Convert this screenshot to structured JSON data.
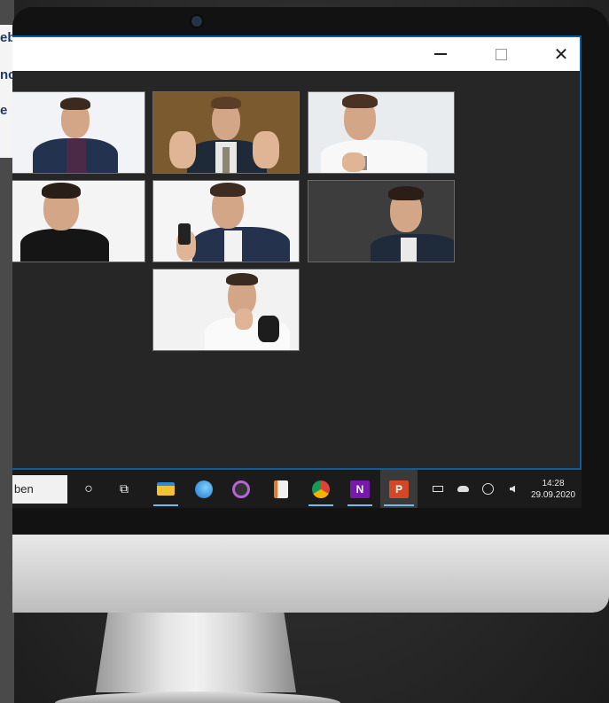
{
  "background_fragments": [
    "eb",
    "nc",
    "e"
  ],
  "window": {
    "minimize_icon": "minimize-icon",
    "maximize_icon": "maximize-icon",
    "close_label": "✕"
  },
  "tiles": [
    {
      "name": "participant-1",
      "bg": "#f1f3f6"
    },
    {
      "name": "participant-2",
      "bg": "#7a5a2e"
    },
    {
      "name": "participant-3",
      "bg": "#e9ecef"
    },
    {
      "name": "participant-4",
      "bg": "#f4f4f4"
    },
    {
      "name": "participant-5",
      "bg": "#f5f5f5"
    },
    {
      "name": "participant-6",
      "bg": "#3d3d3d"
    },
    {
      "name": "participant-7",
      "bg": "#f2f2f2"
    }
  ],
  "taskbar": {
    "search_text": "ben",
    "apps": [
      {
        "name": "cortana-icon",
        "glyph": "○"
      },
      {
        "name": "task-view-icon",
        "glyph": "⧉"
      },
      {
        "name": "file-explorer-icon",
        "glyph": "▬"
      },
      {
        "name": "edge-icon",
        "glyph": "◉"
      },
      {
        "name": "media-player-icon",
        "glyph": "◈"
      },
      {
        "name": "impress-icon",
        "glyph": "▤"
      },
      {
        "name": "chrome-icon",
        "glyph": "●"
      },
      {
        "name": "onenote-icon",
        "glyph": "N"
      },
      {
        "name": "powerpoint-icon",
        "glyph": "P"
      }
    ],
    "tray": {
      "battery_icon": "battery-icon",
      "cloud_icon": "onedrive-icon",
      "network_icon": "network-icon",
      "volume_icon": "volume-icon"
    },
    "time": "14:28",
    "date": "29.09.2020"
  },
  "colors": {
    "accent": "#0c5aa0",
    "taskbar_indicator": "#76b9ed"
  }
}
